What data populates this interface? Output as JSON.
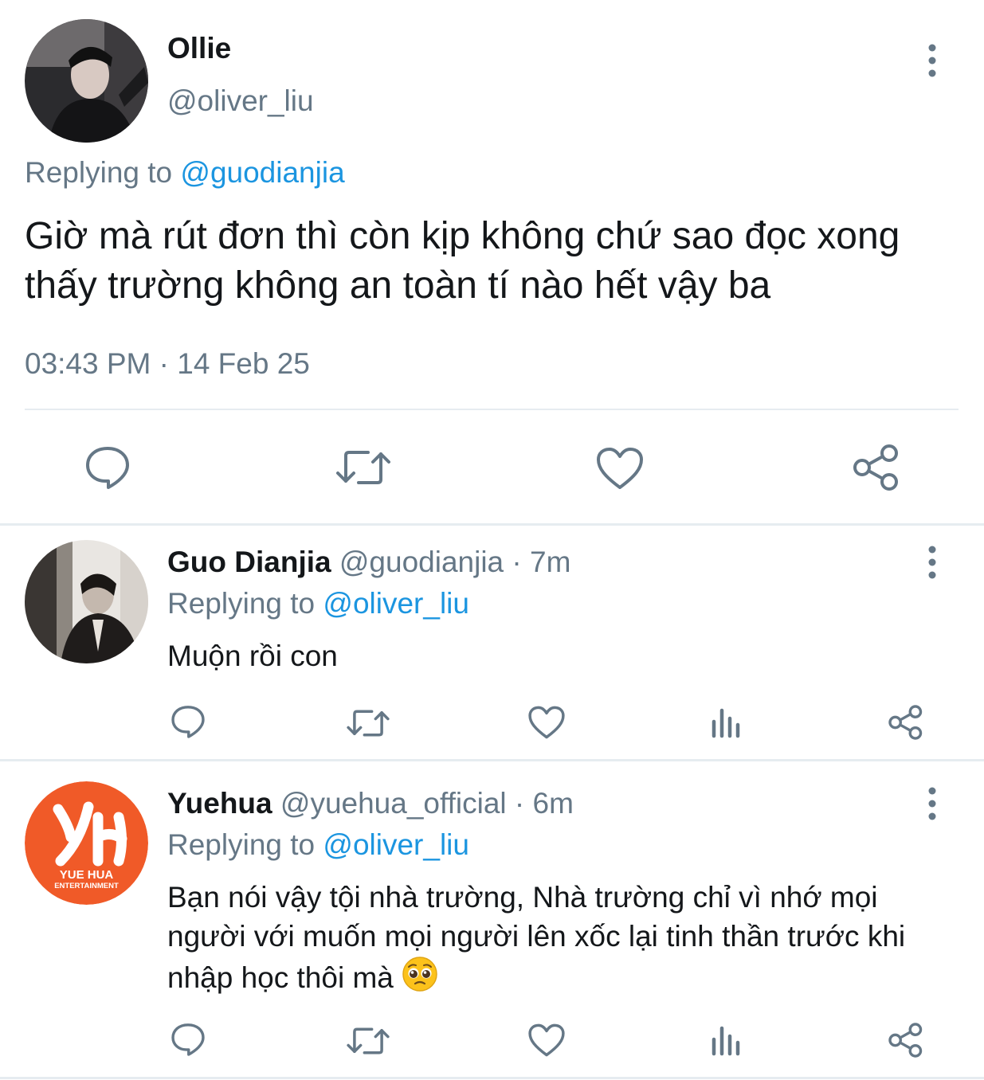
{
  "tweet": {
    "display_name": "Ollie",
    "handle": "@oliver_liu",
    "replying_prefix": "Replying to",
    "replying_to": "@guodianjia",
    "text": "Giờ mà rút đơn thì còn kịp không chứ sao đọc xong thấy trường không an toàn tí nào hết vậy ba",
    "timestamp": "03:43 PM · 14 Feb 25",
    "actions": [
      "reply-icon",
      "retweet-icon",
      "like-icon",
      "share-icon"
    ]
  },
  "replies": [
    {
      "display_name": "Guo Dianjia",
      "handle_time": "@guodianjia · 7m",
      "replying_prefix": "Replying to",
      "replying_to": "@oliver_liu",
      "text": "Muộn rồi con",
      "actions": [
        "reply-icon",
        "retweet-icon",
        "like-icon",
        "analytics-icon",
        "share-icon"
      ]
    },
    {
      "display_name": "Yuehua",
      "handle_time": "@yuehua_official · 6m",
      "replying_prefix": "Replying to",
      "replying_to": "@oliver_liu",
      "text": "Bạn nói vậy tội nhà trường, Nhà trường chỉ vì nhớ mọi người với muốn mọi người lên xốc lại tinh thần trước khi nhập học thôi mà",
      "emoji": "pleading-face-emoji",
      "logo_text": [
        "YUE HUA",
        "ENTERTAINMENT"
      ],
      "actions": [
        "reply-icon",
        "retweet-icon",
        "like-icon",
        "analytics-icon",
        "share-icon"
      ]
    }
  ],
  "colors": {
    "text": "#14171a",
    "secondary": "#657786",
    "mention": "#1b95e0",
    "divider": "#e6ecf0",
    "yuehua_brand": "#f05a28"
  }
}
